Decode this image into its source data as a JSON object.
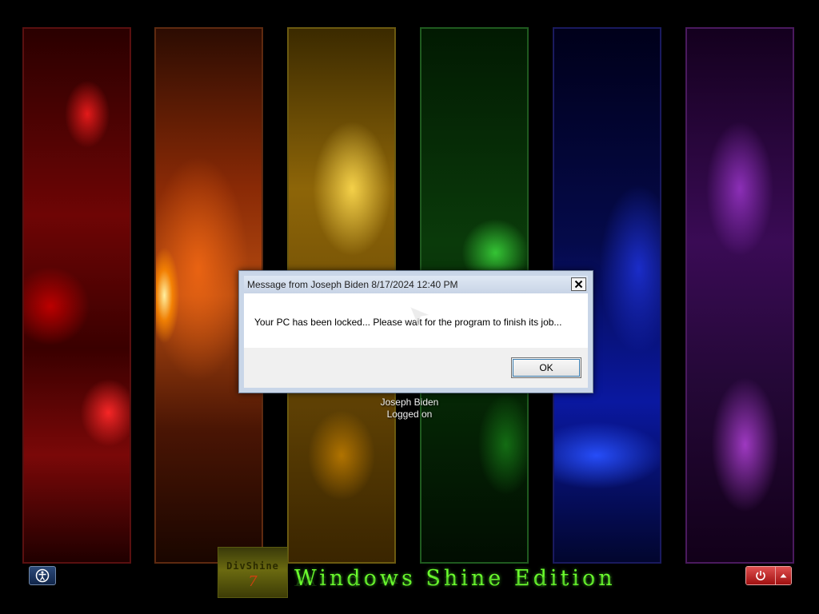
{
  "dialog": {
    "title": "Message from Joseph Biden 8/17/2024 12:40 PM",
    "message": "Your PC has been locked... Please wait for the program to finish its job...",
    "ok_label": "OK",
    "close_label": "✕"
  },
  "user": {
    "name": "Joseph Biden",
    "status": "Logged on"
  },
  "branding": {
    "logo_text": "DivShine",
    "logo_version": "7",
    "title": "Windows Shine Edition"
  },
  "icons": {
    "ease_of_access": "ease-of-access-icon",
    "power": "power-icon",
    "options": "chevron-up-icon",
    "close": "close-icon"
  },
  "colors": {
    "brand_green": "#6cff2e",
    "power_red": "#c02020",
    "dialog_frame": "#c9d6e8"
  }
}
